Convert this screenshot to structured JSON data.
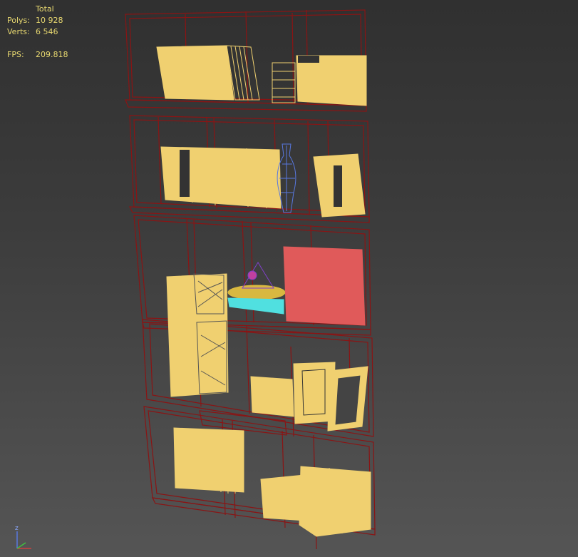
{
  "stats": {
    "header": "Total",
    "polys_label": "Polys:",
    "polys_value": "10 928",
    "verts_label": "Verts:",
    "verts_value": "6 546",
    "fps_label": "FPS:",
    "fps_value": "209.818"
  },
  "axis": {
    "z_label": "z"
  },
  "colors": {
    "frame": "#8a1414",
    "book": "#f0d070",
    "vase": "#5878e0",
    "box_red": "#e05a5a",
    "tray": "#50e0e0",
    "tray_top": "#d8b840",
    "figure": "#8040c8"
  }
}
